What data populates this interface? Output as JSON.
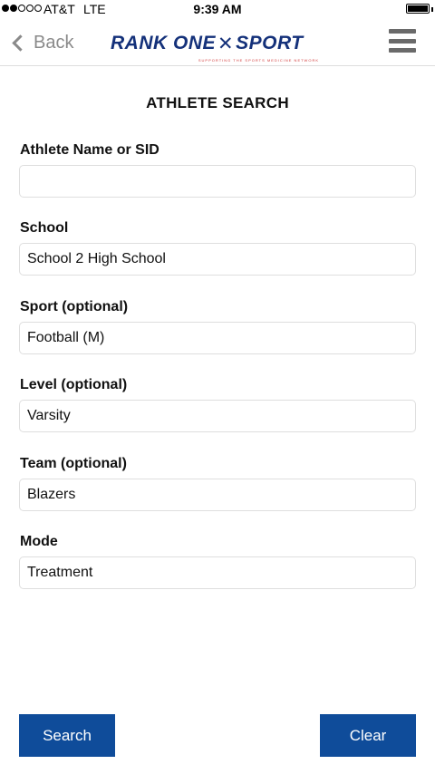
{
  "status_bar": {
    "carrier": "AT&T",
    "network": "LTE",
    "time": "9:39 AM"
  },
  "nav": {
    "back_label": "Back",
    "logo_left": "RANK ONE",
    "logo_mark": "✕",
    "logo_right": "SPORT",
    "logo_tagline": "SUPPORTING THE SPORTS MEDICINE NETWORK",
    "back_icon": "chevron-left-icon",
    "menu_icon": "hamburger-menu-icon"
  },
  "page_title": "ATHLETE SEARCH",
  "fields": [
    {
      "label": "Athlete Name or SID",
      "value": "",
      "placeholder": ""
    },
    {
      "label": "School",
      "value": "School 2 High School"
    },
    {
      "label": "Sport (optional)",
      "value": "Football (M)"
    },
    {
      "label": "Level (optional)",
      "value": "Varsity"
    },
    {
      "label": "Team (optional)",
      "value": "Blazers"
    },
    {
      "label": "Mode",
      "value": "Treatment"
    }
  ],
  "buttons": {
    "search": "Search",
    "clear": "Clear"
  },
  "colors": {
    "brand_blue": "#14317a",
    "button_blue": "#0f4c9a",
    "logo_accent": "#d23a3a"
  }
}
